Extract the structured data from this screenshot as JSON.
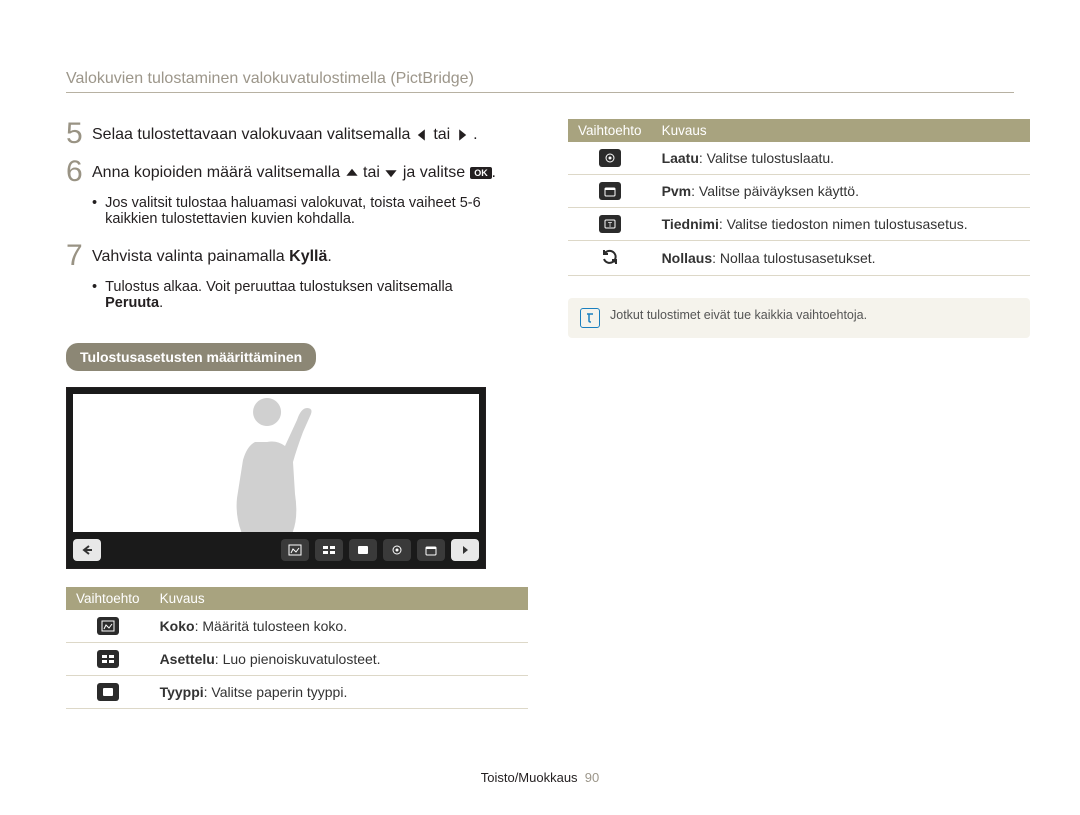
{
  "header": "Valokuvien tulostaminen valokuvatulostimella (PictBridge)",
  "steps": {
    "five": {
      "num": "5",
      "pre": "Selaa tulostettavaan valokuvaan valitsemalla ",
      "mid": " tai ",
      "post": "."
    },
    "six": {
      "num": "6",
      "pre": "Anna kopioiden määrä valitsemalla ",
      "mid": " tai ",
      "post": " ja valitse "
    },
    "six_bullet": "Jos valitsit tulostaa haluamasi valokuvat, toista vaiheet 5-6 kaikkien tulostettavien kuvien kohdalla.",
    "seven": {
      "num": "7",
      "pre": "Vahvista valinta painamalla ",
      "bold": "Kyllä",
      "post": "."
    },
    "seven_bullet_pre": "Tulostus alkaa. Voit peruuttaa tulostuksen valitsemalla ",
    "seven_bullet_bold": "Peruuta",
    "seven_bullet_post": "."
  },
  "section_pill": "Tulostusasetusten määrittäminen",
  "table_headers": {
    "opt": "Vaihtoehto",
    "desc": "Kuvaus"
  },
  "left_rows": [
    {
      "k": "Koko",
      "v": ": Määritä tulosteen koko.",
      "icon": "size"
    },
    {
      "k": "Asettelu",
      "v": ": Luo pienoiskuvatulosteet.",
      "icon": "layout"
    },
    {
      "k": "Tyyppi",
      "v": ": Valitse paperin tyyppi.",
      "icon": "type"
    }
  ],
  "right_rows": [
    {
      "k": "Laatu",
      "v": ": Valitse tulostuslaatu.",
      "icon": "quality"
    },
    {
      "k": "Pvm",
      "v": ": Valitse päiväyksen käyttö.",
      "icon": "date"
    },
    {
      "k": "Tiednimi",
      "v": ": Valitse tiedoston nimen tulostusasetus.",
      "icon": "filename"
    },
    {
      "k": "Nollaus",
      "v": ": Nollaa tulostusasetukset.",
      "icon": "reset"
    }
  ],
  "note": "Jotkut tulostimet eivät tue kaikkia vaihtoehtoja.",
  "footer": {
    "section": "Toisto/Muokkaus",
    "page": "90"
  }
}
